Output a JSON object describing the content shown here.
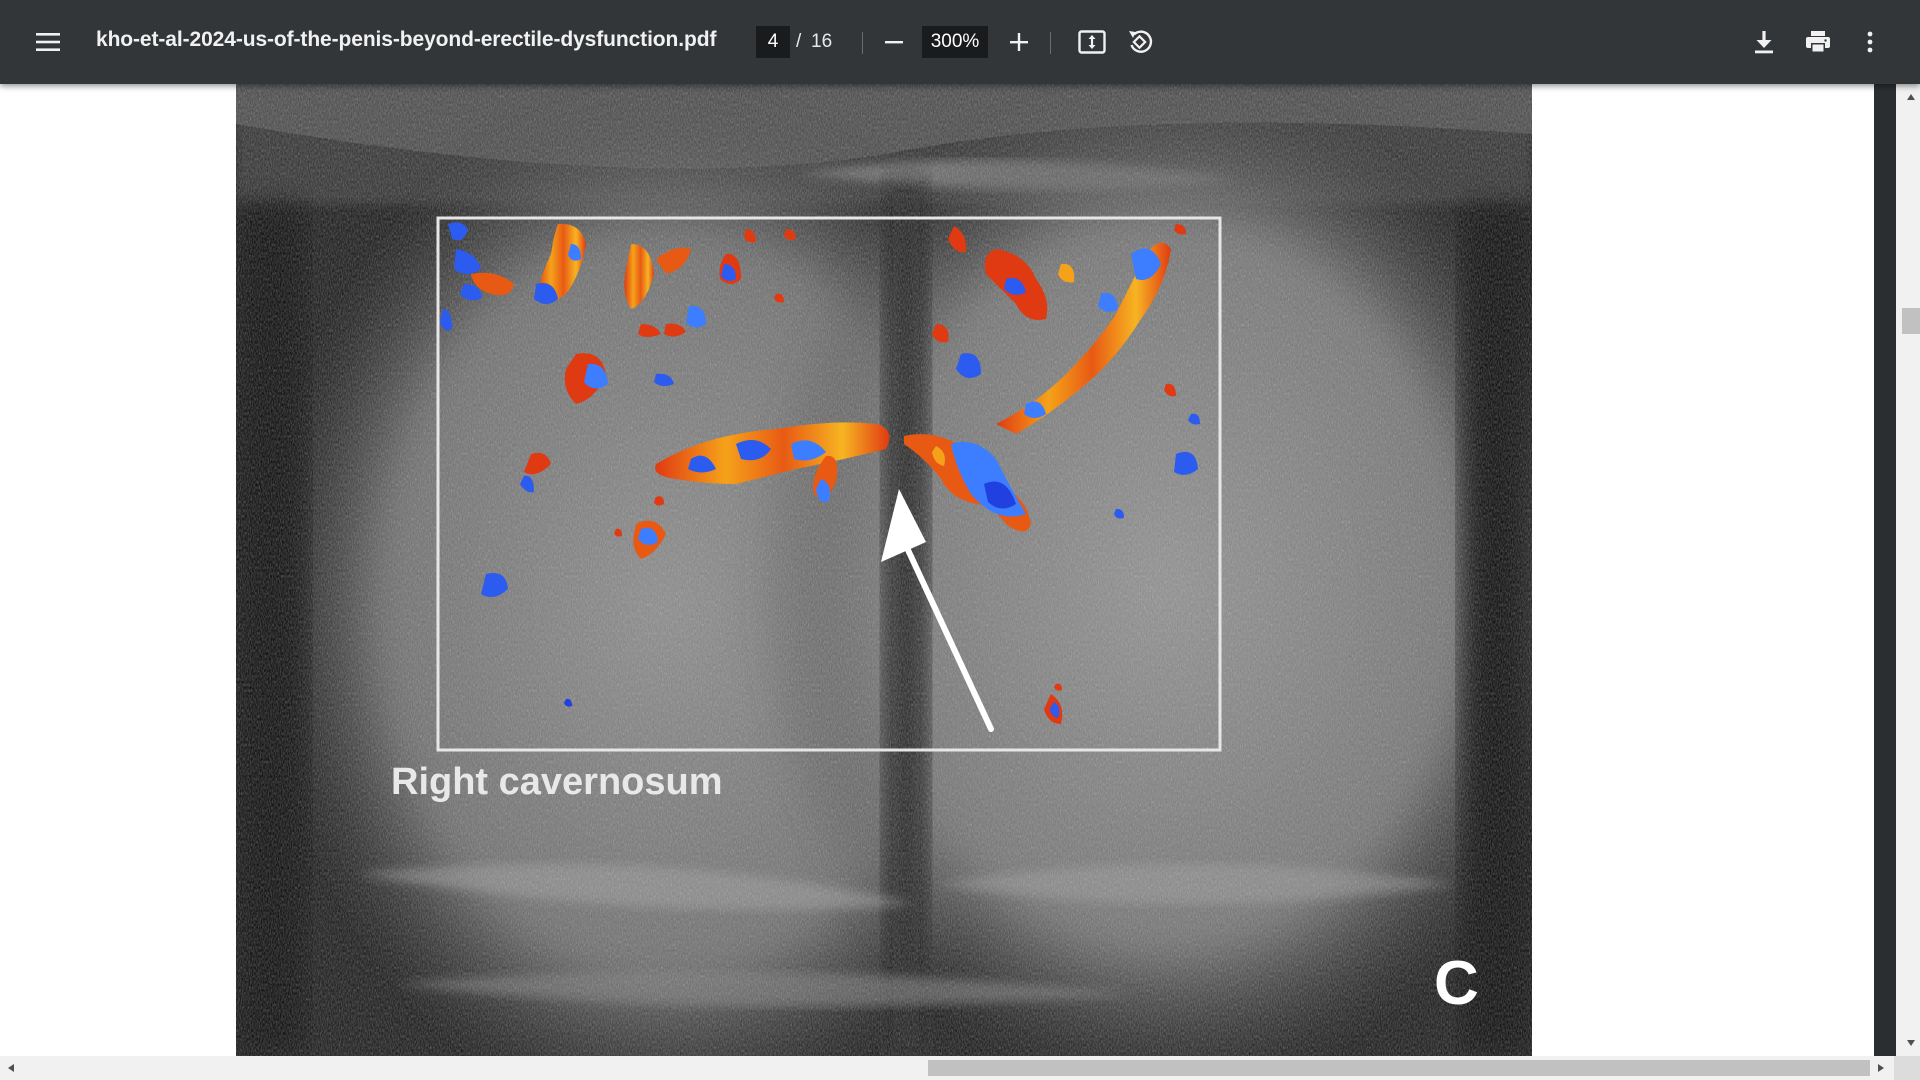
{
  "toolbar": {
    "title": "kho-et-al-2024-us-of-the-penis-beyond-erectile-dysfunction.pdf",
    "page_current": "4",
    "page_separator": "/",
    "page_total": "16",
    "zoom": "300%",
    "icons": {
      "menu": "menu-icon",
      "zoom_out": "minus-icon",
      "zoom_in": "plus-icon",
      "fit": "fit-to-page-icon",
      "rotate": "rotate-counterclockwise-icon",
      "download": "download-icon",
      "print": "print-icon",
      "more": "more-vertical-icon"
    }
  },
  "figure": {
    "label": "Right cavernosum",
    "panel_letter": "C"
  },
  "colors": {
    "toolbar_bg": "#323639",
    "viewer_bg": "#525659",
    "doppler_red": "#e03a12",
    "doppler_orange": "#f5a21a",
    "doppler_blue": "#2c5bf0"
  }
}
